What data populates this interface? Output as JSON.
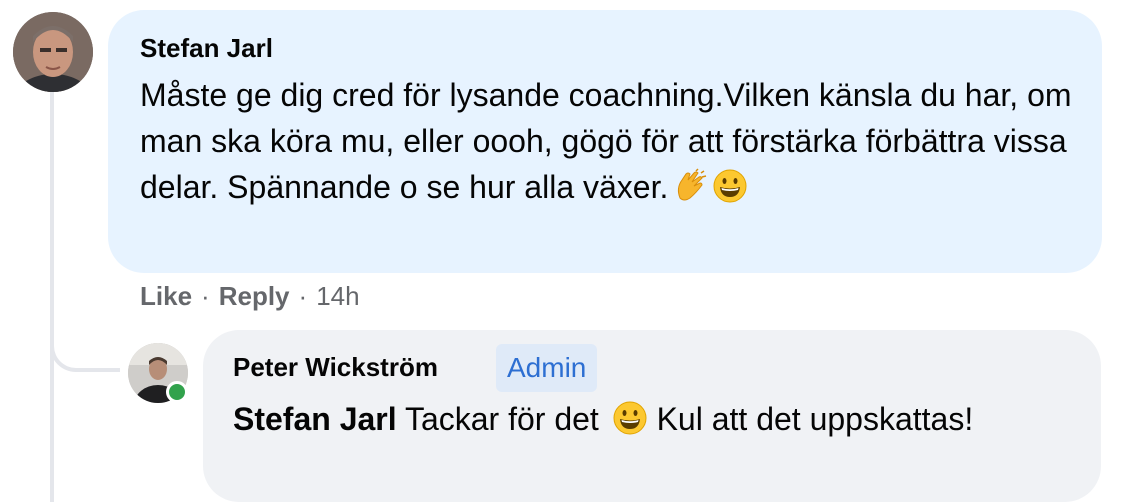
{
  "comment": {
    "author": "Stefan Jarl",
    "text": "Måste ge dig cred för lysande coachning.Vilken känsla du har, om man ska köra mu, eller oooh, gögö för att förstärka förbättra vissa delar. Spännande o se hur alla växer.",
    "emojis": [
      "clapping-hands",
      "grinning-face"
    ],
    "actions": {
      "like": "Like",
      "separator": "·",
      "reply": "Reply",
      "time": "14h"
    }
  },
  "reply": {
    "author": "Peter Wickström",
    "badge": "Admin",
    "mention": "Stefan Jarl",
    "text_part1": "Tackar för det",
    "text_part2": "Kul att det uppskattas!",
    "online": true
  },
  "colors": {
    "bubble_comment": "#e7f3ff",
    "bubble_reply": "#f0f2f5",
    "badge_text": "#2d6fd2",
    "badge_bg": "#dfeaf8",
    "meta_text": "#65676b",
    "online": "#31a24c"
  }
}
